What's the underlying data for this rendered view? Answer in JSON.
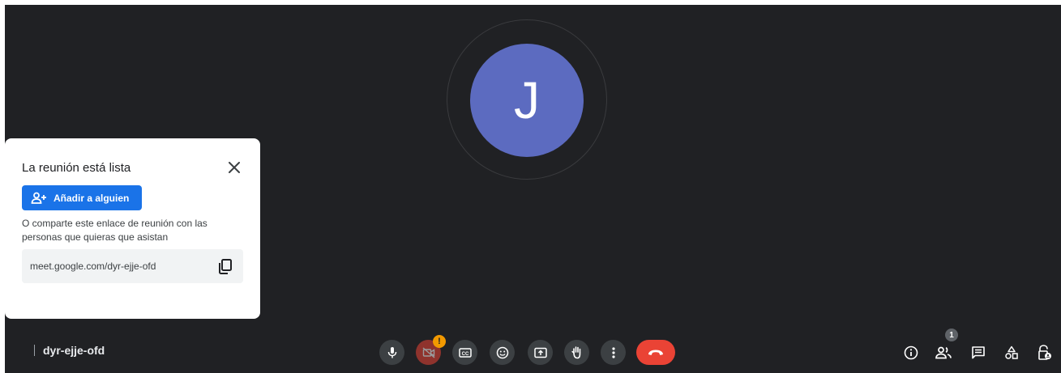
{
  "participant": {
    "initial": "J"
  },
  "ready_card": {
    "title": "La reunión está lista",
    "add_button_label": "Añadir a alguien",
    "description": "O comparte este enlace de reunión con las personas que quieras que asistan",
    "meeting_link": "meet.google.com/dyr-ejje-ofd"
  },
  "meeting": {
    "code": "dyr-ejje-ofd"
  },
  "controls": {
    "camera_warning": "!",
    "icons": [
      "mic-icon",
      "camera-off-icon",
      "captions-icon",
      "emoji-icon",
      "present-icon",
      "raise-hand-icon",
      "more-options-icon",
      "hangup-icon"
    ]
  },
  "side_panel": {
    "people_count": "1",
    "icons": [
      "info-icon",
      "people-icon",
      "chat-icon",
      "activities-icon",
      "host-controls-icon"
    ]
  },
  "colors": {
    "background": "#202124",
    "avatar": "#5c6bc0",
    "primary": "#1a73e8",
    "danger": "#ea4335",
    "warning": "#f29900"
  }
}
